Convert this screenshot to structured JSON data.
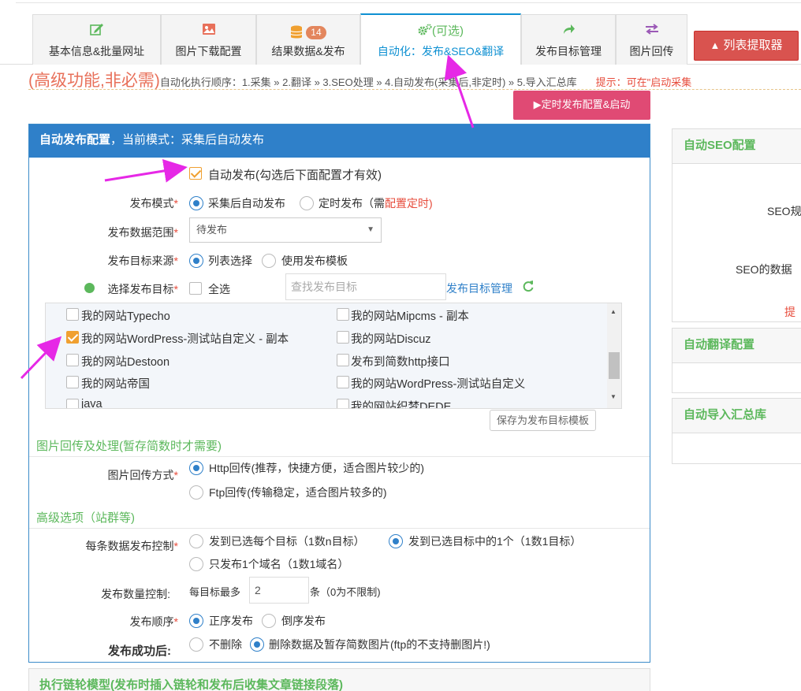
{
  "tabs": [
    {
      "label": "基本信息&批量网址",
      "icon": "edit-icon"
    },
    {
      "label": "图片下载配置",
      "icon": "image-icon"
    },
    {
      "label": "结果数据&发布",
      "icon": "database-icon",
      "badge": "14"
    },
    {
      "label": "自动化：发布&SEO&翻译",
      "top_label": "(可选)",
      "icon": "gears-icon"
    },
    {
      "label": "发布目标管理",
      "icon": "share-icon"
    },
    {
      "label": "图片回传",
      "icon": "exchange-icon"
    }
  ],
  "list_extractor_button": "列表提取器",
  "banner": {
    "title": "(高级功能,非必需)",
    "order": "自动化执行顺序：1.采集 » 2.翻译 » 3.SEO处理 » 4.自动发布(采集后,非定时) » 5.导入汇总库",
    "tip": "提示：可在\"启动采集"
  },
  "schedule_button": "▶定时发布配置&启动",
  "panel": {
    "title": "自动发布配置，当前模式：采集后自动发布",
    "title_bold": "自动发布配置",
    "title_rest": "，当前模式：采集后自动发布",
    "auto_publish": "自动发布(勾选后下面配置才有效)",
    "mode_label": "发布模式",
    "mode_opt1": "采集后自动发布",
    "mode_opt2": "定时发布（需",
    "mode_opt2_link": "配置定时",
    "mode_opt2_end": ")",
    "range_label": "发布数据范围",
    "range_value": "待发布",
    "source_label": "发布目标来源",
    "source_opt1": "列表选择",
    "source_opt2": "使用发布模板",
    "target_label": "选择发布目标",
    "select_all": "全选",
    "search_placeholder": "查找发布目标",
    "target_manage": "发布目标管理",
    "targets_left": [
      "我的网站Typecho",
      "我的网站WordPress-测试站自定义 - 副本",
      "我的网站Destoon",
      "我的网站帝国",
      "java"
    ],
    "targets_right": [
      "我的网站Mipcms - 副本",
      "我的网站Discuz",
      "发布到简数http接口",
      "我的网站WordPress-测试站自定义",
      "我的网站织梦DEDE"
    ],
    "save_template": "保存为发布目标模板",
    "img_section": "图片回传及处理(暂存简数时才需要)",
    "img_label": "图片回传方式",
    "img_opt1": "Http回传(推荐，快捷方便，适合图片较少的)",
    "img_opt2": "Ftp回传(传输稳定，适合图片较多的)",
    "adv_section": "高级选项（站群等)",
    "ctrl_label": "每条数据发布控制",
    "ctrl_opt1": "发到已选每个目标（1数n目标）",
    "ctrl_opt2": "发到已选目标中的1个（1数1目标）",
    "ctrl_opt3": "只发布1个域名（1数1域名）",
    "count_label": "发布数量控制:",
    "count_prefix": "每目标最多",
    "count_value": "2",
    "count_suffix": "条（0为不限制)",
    "order_label": "发布顺序",
    "order_opt1": "正序发布",
    "order_opt2": "倒序发布",
    "after_label": "发布成功后:",
    "after_opt1": "不删除",
    "after_opt2": "删除数据及暂存简数图片(ftp的不支持删图片!)"
  },
  "bottom_section": "执行链轮模型(发布时插入链轮和发布后收集文章链接段落)",
  "side": {
    "seo_title": "自动SEO配置",
    "seo_line1": "SEO规",
    "seo_line2": "SEO的数据",
    "seo_tip": "提",
    "translate_title": "自动翻译配置",
    "import_title": "自动导入汇总库"
  },
  "colors": {
    "primary": "#2f80c9",
    "green": "#5cb85c",
    "orange": "#f0a030",
    "red": "#d9534f",
    "pink": "#e04a74",
    "arrow": "#e628e6"
  }
}
